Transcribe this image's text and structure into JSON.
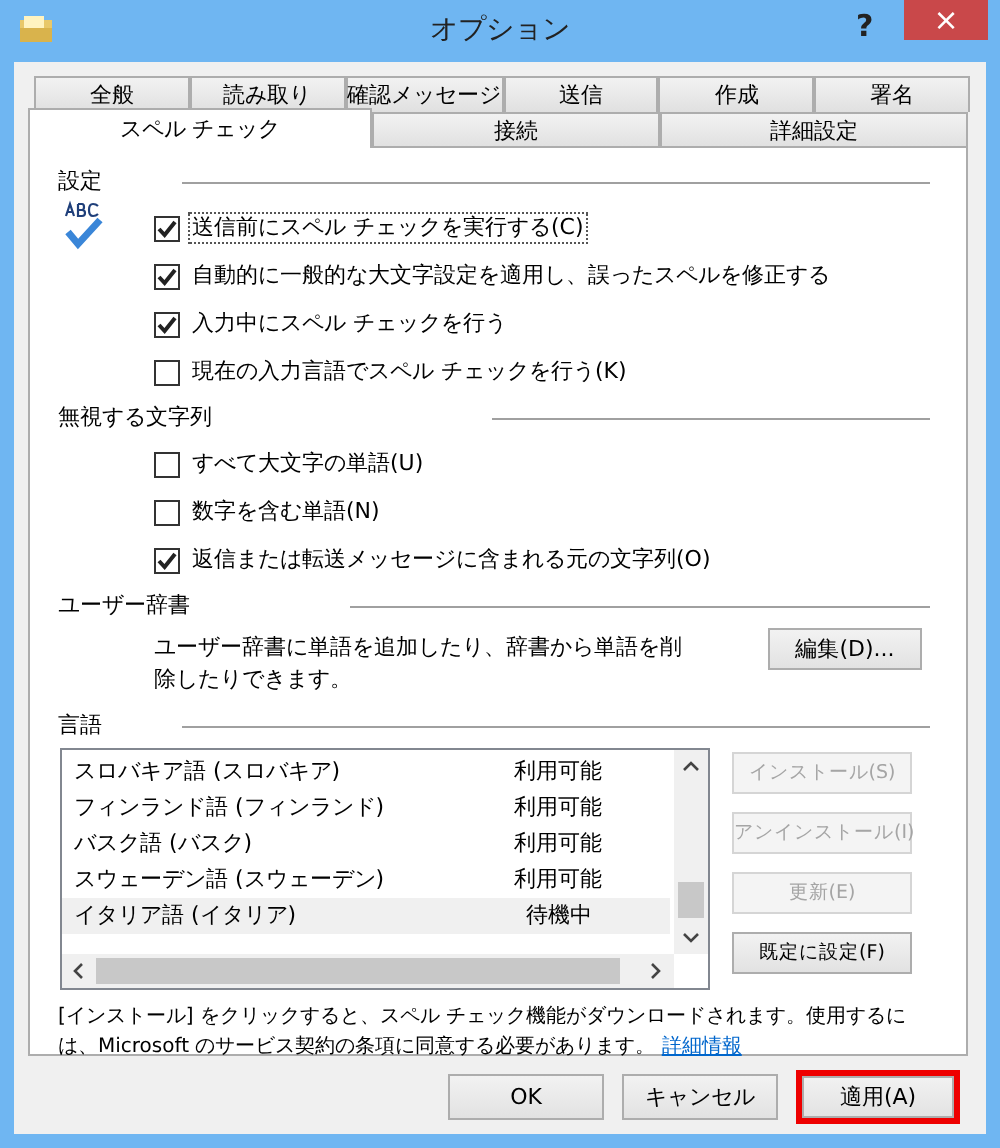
{
  "window": {
    "title": "オプション",
    "help": "?",
    "close": "×"
  },
  "tabs_back": [
    {
      "label": "全般",
      "selected": false
    },
    {
      "label": "読み取り",
      "selected": false
    },
    {
      "label": "確認メッセージ",
      "selected": false
    },
    {
      "label": "送信",
      "selected": false
    },
    {
      "label": "作成",
      "selected": false
    },
    {
      "label": "署名",
      "selected": false
    }
  ],
  "tabs_front": [
    {
      "label": "スペル チェック",
      "selected": true
    },
    {
      "label": "接続",
      "selected": false
    },
    {
      "label": "詳細設定",
      "selected": false
    }
  ],
  "sections": [
    {
      "title": "設定",
      "options": [
        {
          "label": "送信前にスペル チェックを実行する(C)",
          "checked": true,
          "focused": true
        },
        {
          "label": "自動的に一般的な大文字設定を適用し、誤ったスペルを修正する",
          "checked": true,
          "focused": false
        },
        {
          "label": "入力中にスペル チェックを行う",
          "checked": true,
          "focused": false
        },
        {
          "label": "現在の入力言語でスペル チェックを行う(K)",
          "checked": false,
          "focused": false
        }
      ]
    },
    {
      "title": "無視する文字列",
      "options": [
        {
          "label": "すべて大文字の単語(U)",
          "checked": false,
          "focused": false
        },
        {
          "label": "数字を含む単語(N)",
          "checked": false,
          "focused": false
        },
        {
          "label": "返信または転送メッセージに含まれる元の文字列(O)",
          "checked": true,
          "focused": false
        }
      ]
    }
  ],
  "dictionary": {
    "title": "ユーザー辞書",
    "description": "ユーザー辞書に単語を追加したり、辞書から単語を削除したりできます。",
    "button": "編集(D)..."
  },
  "languages": {
    "title": "言語",
    "rows": [
      {
        "name": "スロバキア語 (スロバキア)",
        "status": "利用可能",
        "selected": false
      },
      {
        "name": "フィンランド語 (フィンランド)",
        "status": "利用可能",
        "selected": false
      },
      {
        "name": "バスク語 (バスク)",
        "status": "利用可能",
        "selected": false
      },
      {
        "name": "スウェーデン語 (スウェーデン)",
        "status": "利用可能",
        "selected": false
      },
      {
        "name": "イタリア語 (イタリア)",
        "status": "待機中",
        "selected": true
      }
    ],
    "buttons": [
      {
        "label": "インストール(S)",
        "disabled": true
      },
      {
        "label": "アンインストール(I)",
        "disabled": true
      },
      {
        "label": "更新(E)",
        "disabled": true
      },
      {
        "label": "既定に設定(F)",
        "disabled": false
      }
    ],
    "note": "[インストール] をクリックすると、スペル チェック機能がダウンロードされます。使用するには、Microsoft のサービス契約の条項に同意する必要があります。",
    "link": "詳細情報"
  },
  "buttons": [
    {
      "label": "OK",
      "highlighted": false
    },
    {
      "label": "キャンセル",
      "highlighted": false
    },
    {
      "label": "適用(A)",
      "highlighted": true
    }
  ]
}
